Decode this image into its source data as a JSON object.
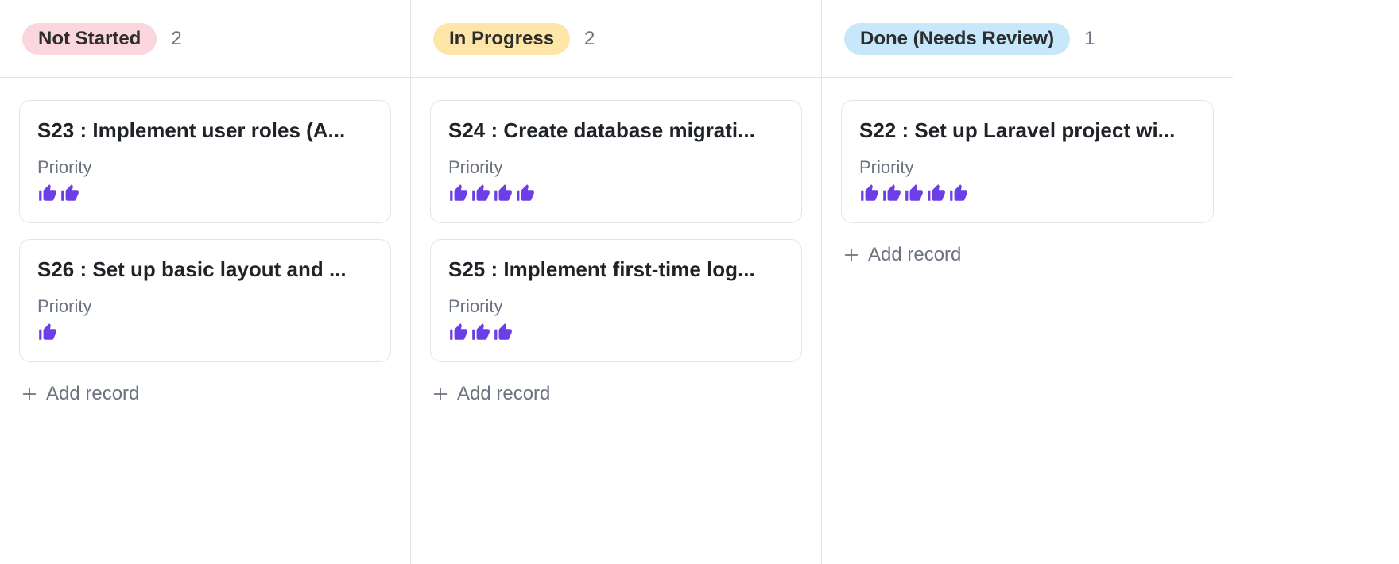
{
  "labels": {
    "priority": "Priority",
    "add_record": "Add record"
  },
  "colors": {
    "thumb": "#6b3ee8",
    "muted": "#6b7280",
    "pill_not_started_bg": "#fcd6df",
    "pill_in_progress_bg": "#fde6a7",
    "pill_done_review_bg": "#c7e7fb"
  },
  "columns": [
    {
      "id": "not_started",
      "status_label": "Not Started",
      "count": "2",
      "pill_class": "pill-not-started",
      "cards": [
        {
          "title": "S23 : Implement user roles (A...",
          "priority_thumbs": 2
        },
        {
          "title": "S26 : Set up basic layout and ...",
          "priority_thumbs": 1
        }
      ]
    },
    {
      "id": "in_progress",
      "status_label": "In Progress",
      "count": "2",
      "pill_class": "pill-in-progress",
      "cards": [
        {
          "title": "S24 : Create database migrati...",
          "priority_thumbs": 4
        },
        {
          "title": "S25 : Implement first-time log...",
          "priority_thumbs": 3
        }
      ]
    },
    {
      "id": "done_review",
      "status_label": "Done (Needs Review)",
      "count": "1",
      "pill_class": "pill-done-review",
      "cards": [
        {
          "title": "S22 : Set up Laravel project wi...",
          "priority_thumbs": 5
        }
      ]
    }
  ]
}
